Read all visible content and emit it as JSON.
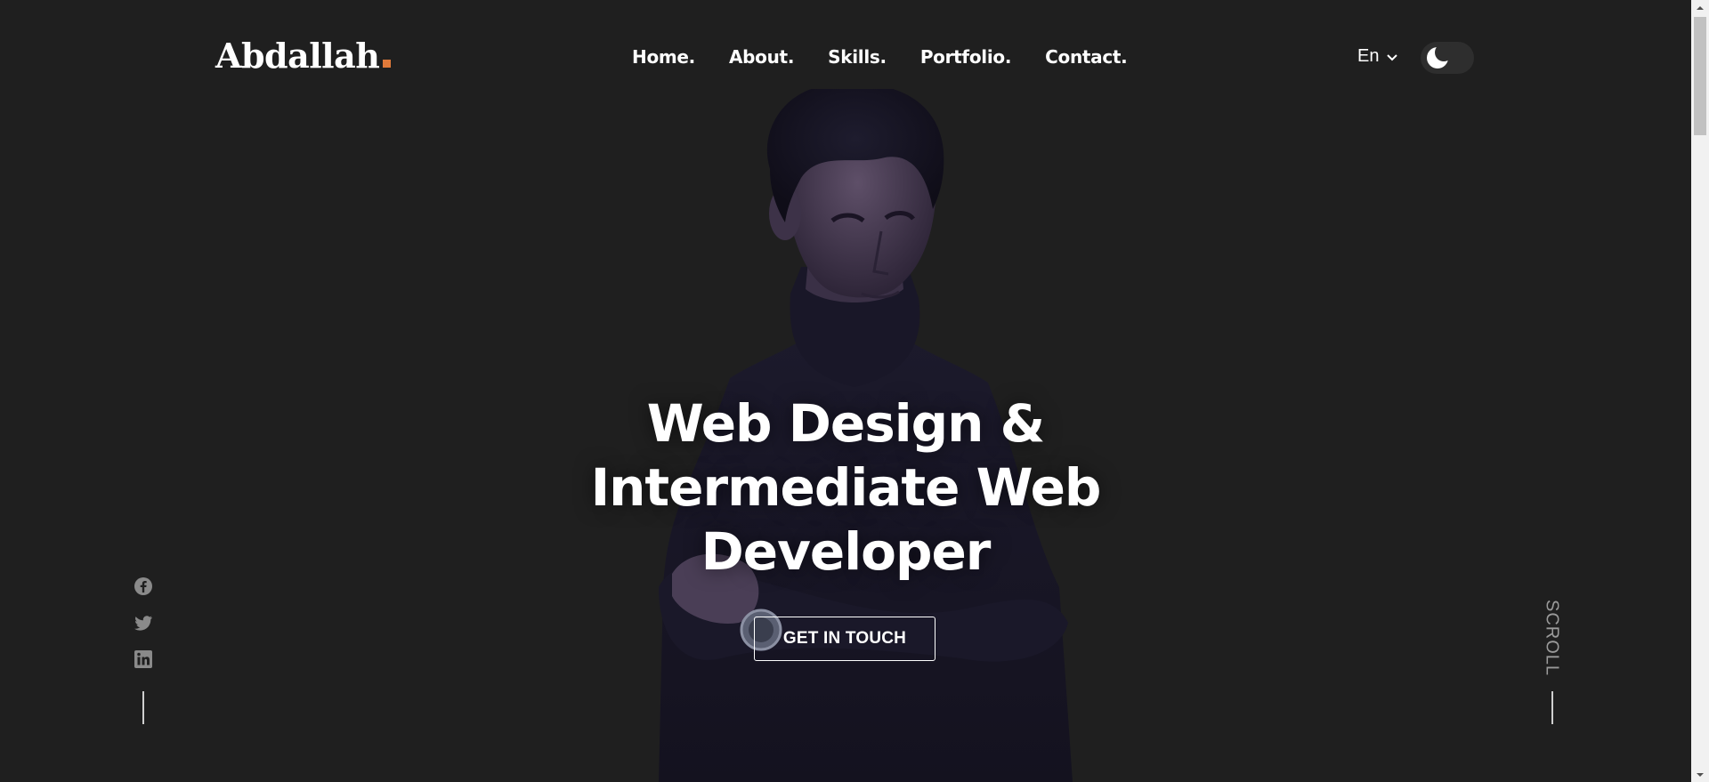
{
  "header": {
    "logo": "Abdallah",
    "logo_accent_color": "#e07a3a",
    "nav": [
      {
        "label": "Home."
      },
      {
        "label": "About."
      },
      {
        "label": "Skills."
      },
      {
        "label": "Portfolio."
      },
      {
        "label": "Contact."
      }
    ],
    "language": "En",
    "theme_icon": "moon-icon"
  },
  "hero": {
    "title_line1": "Web Design &",
    "title_line2": "Intermediate Web",
    "title_line3": "Developer",
    "cta_label": "GET IN TOUCH",
    "image": "portrait-photo"
  },
  "social": {
    "icons": [
      "facebook-icon",
      "twitter-icon",
      "linkedin-icon"
    ]
  },
  "scroll_indicator": {
    "label": "SCROLL"
  },
  "colors": {
    "background": "#1f1f1f",
    "text": "#ffffff",
    "muted": "#9a9a9a"
  }
}
